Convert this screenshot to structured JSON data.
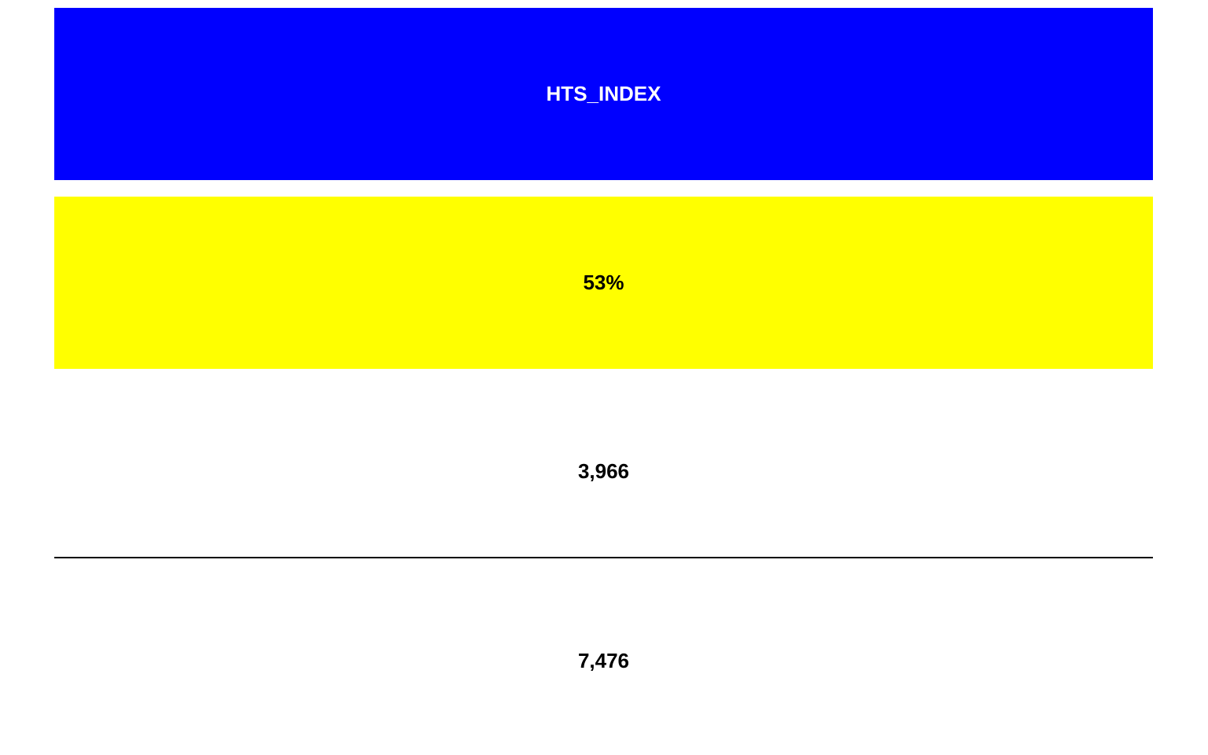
{
  "indicator": {
    "title": "HTS_INDEX",
    "ratio": "53%",
    "numerator": "3,966",
    "denominator": "7,476",
    "progress_percent": 53
  },
  "colors": {
    "header_bg": "#0000ff",
    "header_text": "#ffffff",
    "ratio_bg": "#ffff00",
    "value_text": "#000000",
    "page_bg": "#ffffff",
    "divider": "#000000"
  }
}
